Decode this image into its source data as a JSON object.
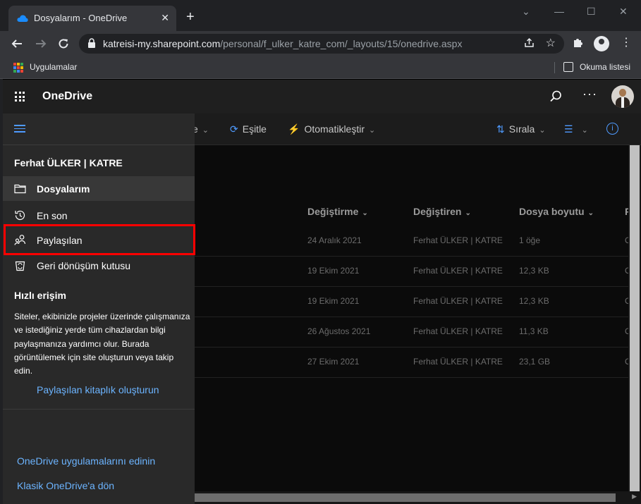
{
  "browser": {
    "tab_title": "Dosyalarım - OneDrive",
    "tab_close": "✕",
    "new_tab": "+",
    "window_controls": {
      "minimize": "—",
      "maximize": "☐",
      "close": "✕",
      "tab_search": "⌄"
    },
    "url_host": "katreisi-my.sharepoint.com",
    "url_path": "/personal/f_ulker_katre_com/_layouts/15/onedrive.aspx",
    "bookmarks_apps_label": "Uygulamalar",
    "reading_list_label": "Okuma listesi",
    "apps_colors": [
      "#ea4335",
      "#fbbc04",
      "#34a853",
      "#4285f4",
      "#ea4335",
      "#fbbc04",
      "#34a853",
      "#4285f4",
      "#ea4335"
    ]
  },
  "suitebar": {
    "brand": "OneDrive",
    "more": "···"
  },
  "commandbar": {
    "partial_label": "tle",
    "sync_label": "Eşitle",
    "automate_label": "Otomatikleştir",
    "sort_label": "Sırala",
    "info_label": "i"
  },
  "colors": {
    "accent": "#4f9bff",
    "link": "#6cb4ff",
    "highlight": "#ff0000"
  },
  "table": {
    "headers": [
      "Değiştirme",
      "Değiştiren",
      "Dosya boyutu",
      "P"
    ],
    "rows": [
      {
        "modified": "24 Aralık 2021",
        "modified_by": "Ferhat ÜLKER | KATRE",
        "size": "1 öğe",
        "extra": "O"
      },
      {
        "modified": "19 Ekim 2021",
        "modified_by": "Ferhat ÜLKER | KATRE",
        "size": "12,3 KB",
        "extra": "O"
      },
      {
        "modified": "19 Ekim 2021",
        "modified_by": "Ferhat ÜLKER | KATRE",
        "size": "12,3 KB",
        "extra": "O"
      },
      {
        "modified": "26 Ağustos 2021",
        "modified_by": "Ferhat ÜLKER | KATRE",
        "size": "11,3 KB",
        "extra": "O"
      },
      {
        "modified": "27 Ekim 2021",
        "modified_by": "Ferhat ÜLKER | KATRE",
        "size": "23,1 GB",
        "extra": "O"
      }
    ]
  },
  "nav": {
    "user": "Ferhat ÜLKER | KATRE",
    "items": [
      {
        "label": "Dosyalarım",
        "icon": "folder-icon",
        "selected": true
      },
      {
        "label": "En son",
        "icon": "history-icon"
      },
      {
        "label": "Paylaşılan",
        "icon": "people-icon"
      },
      {
        "label": "Geri dönüşüm kutusu",
        "icon": "recycle-bin-icon"
      }
    ],
    "quick_access_title": "Hızlı erişim",
    "quick_access_desc": "Siteler, ekibinizle projeler üzerinde çalışmanıza ve istediğiniz yerde tüm cihazlardan bilgi paylaşmanıza yardımcı olur. Burada görüntülemek için site oluşturun veya takip edin.",
    "create_shared_library": "Paylaşılan kitaplık oluşturun",
    "get_apps": "OneDrive uygulamalarını edinin",
    "classic": "Klasik OneDrive'a dön"
  }
}
